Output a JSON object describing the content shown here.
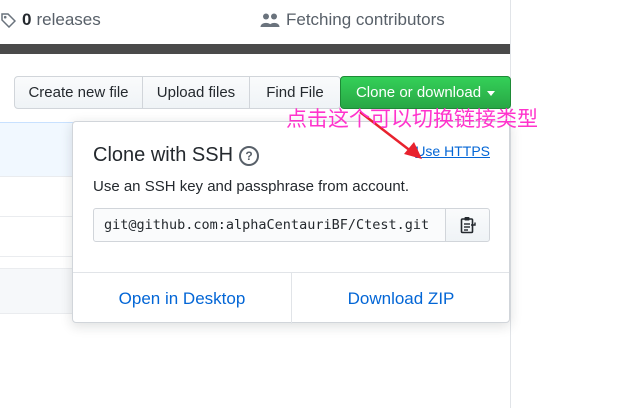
{
  "stats": {
    "releases_count": "0",
    "releases_label": "releases",
    "contributors_label": "Fetching contributors"
  },
  "toolbar": {
    "create_new_file": "Create new file",
    "upload_files": "Upload files",
    "find_file": "Find File",
    "clone_or_download": "Clone or download"
  },
  "clone_popup": {
    "title": "Clone with SSH",
    "help_glyph": "?",
    "use_https_link": "Use HTTPS",
    "description": "Use an SSH key and passphrase from account.",
    "clone_url": "git@github.com:alphaCentauriBF/Ctest.git",
    "open_in_desktop": "Open in Desktop",
    "download_zip": "Download ZIP"
  },
  "annotation": {
    "text": "点击这个可以切换链接类型",
    "color": "#ff33cc",
    "arrow_color": "#e8222e"
  },
  "colors": {
    "accent_green": "#28a745",
    "link_blue": "#0366d6"
  },
  "icons": {
    "releases": "tag-icon",
    "contributors": "people-icon",
    "copy": "clippy-icon",
    "dropdown": "caret-down-icon",
    "help": "question-circle-icon"
  }
}
